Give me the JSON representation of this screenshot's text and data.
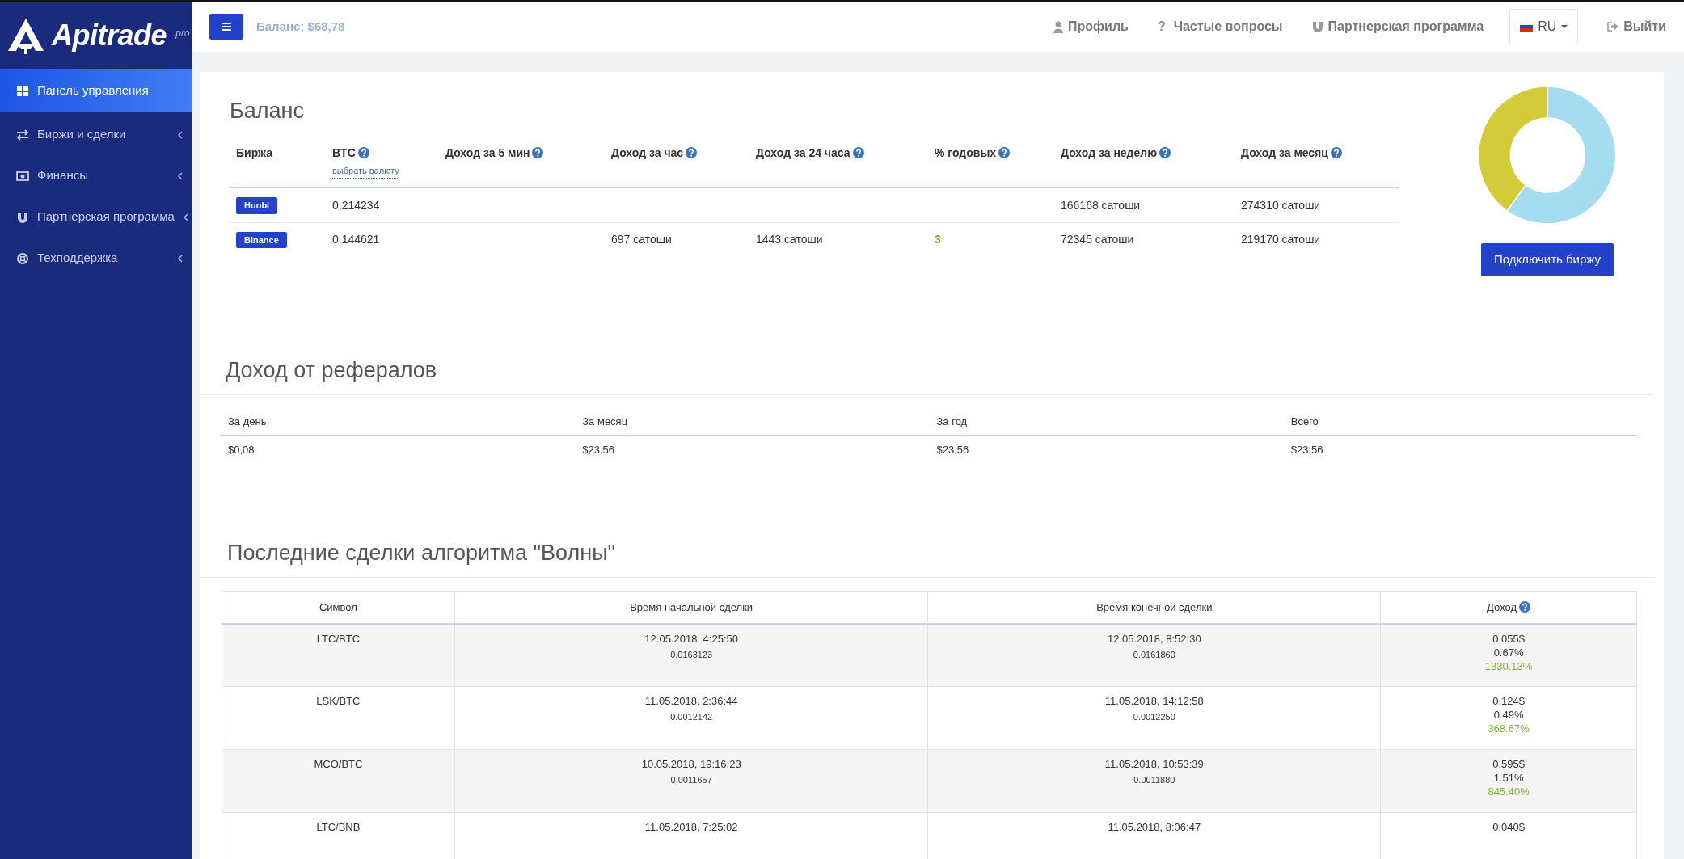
{
  "sidebar": {
    "logo": {
      "name": "Apitrade",
      "suffix": ".pro"
    },
    "items": [
      {
        "label": "Панель управления",
        "selected": true,
        "submenu": false
      },
      {
        "label": "Биржи и сделки",
        "selected": false,
        "submenu": true
      },
      {
        "label": "Финансы",
        "selected": false,
        "submenu": true
      },
      {
        "label": "Партнерская программа",
        "selected": false,
        "submenu": true
      },
      {
        "label": "Техподдержка",
        "selected": false,
        "submenu": true
      }
    ]
  },
  "topbar": {
    "balance": "Баланс: $68,78",
    "nav": [
      {
        "label": "Профиль"
      },
      {
        "label": "Частые вопросы",
        "glyph": "?"
      },
      {
        "label": "Партнерская программа"
      }
    ],
    "language": "RU",
    "logout": "Выйти"
  },
  "balance": {
    "title": "Баланс",
    "columns": [
      {
        "label": "Биржа",
        "help": false
      },
      {
        "label": "BTC",
        "help": true,
        "link": "выбрать валюту"
      },
      {
        "label": "Доход за 5 мин",
        "help": true
      },
      {
        "label": "Доход за час",
        "help": true
      },
      {
        "label": "Доход за 24 часа",
        "help": true
      },
      {
        "label": "% годовых",
        "help": true
      },
      {
        "label": "Доход за неделю",
        "help": true
      },
      {
        "label": "Доход за месяц",
        "help": true
      }
    ],
    "rows": [
      {
        "exchange": "Huobi",
        "btc": "0,214234",
        "week": "166168 сатоши",
        "month": "274310 сатоши"
      },
      {
        "exchange": "Binance",
        "btc": "0,144621",
        "hour": "697 сатоши",
        "day": "1443 сатоши",
        "annual": "3",
        "week": "72345 сатоши",
        "month": "219170 сатоши"
      }
    ],
    "connect_button": "Подключить биржу"
  },
  "referrals": {
    "title": "Доход от рефералов",
    "columns": [
      "За день",
      "За месяц",
      "За год",
      "Всего"
    ],
    "values": [
      "$0,08",
      "$23,56",
      "$23,56",
      "$23,56"
    ]
  },
  "deals": {
    "title": "Последние сделки алгоритма \"Волны\"",
    "columns": [
      {
        "label": "Символ",
        "help": false
      },
      {
        "label": "Время начальной сделки",
        "help": false
      },
      {
        "label": "Время конечной сделки",
        "help": false
      },
      {
        "label": "Доход",
        "help": true
      }
    ],
    "rows": [
      {
        "symbol": "LTC/BTC",
        "open_time": "12.05.2018, 4:25:50",
        "open_price": "0.0163123",
        "close_time": "12.05.2018, 8:52:30",
        "close_price": "0.0161860",
        "income_usd": "0.055$",
        "income_percent": "0.67%",
        "income_annual": "1330.13%"
      },
      {
        "symbol": "LSK/BTC",
        "open_time": "11.05.2018, 2:36:44",
        "open_price": "0.0012142",
        "close_time": "11.05.2018, 14:12:58",
        "close_price": "0.0012250",
        "income_usd": "0.124$",
        "income_percent": "0.49%",
        "income_annual": "368.67%"
      },
      {
        "symbol": "MCO/BTC",
        "open_time": "10.05.2018, 19:16:23",
        "open_price": "0.0011657",
        "close_time": "11.05.2018, 10:53:39",
        "close_price": "0.0011880",
        "income_usd": "0.595$",
        "income_percent": "1.51%",
        "income_annual": "845.40%"
      },
      {
        "symbol": "LTC/BNB",
        "open_time": "11.05.2018, 7:25:02",
        "close_time": "11.05.2018, 8:06:47",
        "income_usd": "0.040$"
      }
    ]
  }
}
